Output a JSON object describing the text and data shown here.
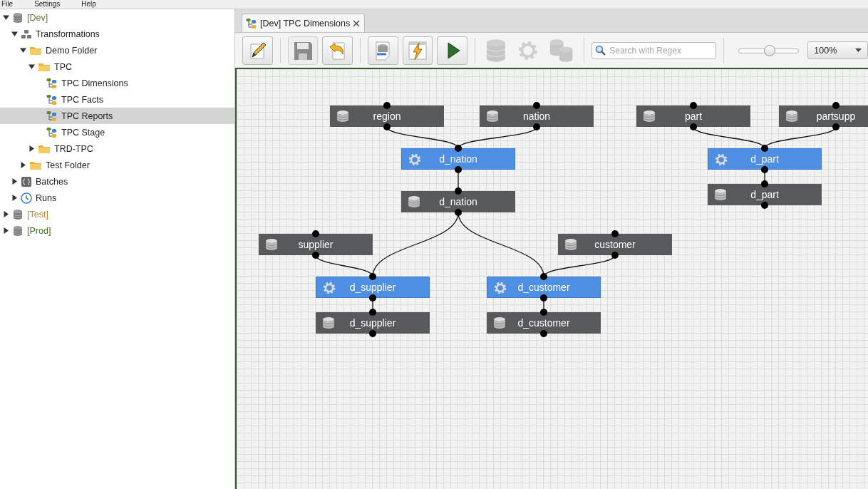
{
  "menu": [
    "File",
    "Settings",
    "Help"
  ],
  "tree": [
    {
      "label": "[Dev]",
      "kind": "env",
      "color": "#5a7a2c",
      "expanded": true,
      "selected": false,
      "children": [
        {
          "label": "Transformations",
          "kind": "transformations",
          "expanded": true,
          "selected": false,
          "children": [
            {
              "label": "Demo Folder",
              "kind": "folder",
              "expanded": true,
              "selected": false,
              "children": [
                {
                  "label": "TPC",
                  "kind": "folder",
                  "expanded": true,
                  "selected": false,
                  "children": [
                    {
                      "label": "TPC Dimensions",
                      "kind": "transformation",
                      "selected": false
                    },
                    {
                      "label": "TPC Facts",
                      "kind": "transformation",
                      "selected": false
                    },
                    {
                      "label": "TPC Reports",
                      "kind": "transformation",
                      "selected": true
                    },
                    {
                      "label": "TPC Stage",
                      "kind": "transformation",
                      "selected": false
                    }
                  ]
                },
                {
                  "label": "TRD-TPC",
                  "kind": "folder",
                  "expanded": false,
                  "selected": false
                }
              ]
            },
            {
              "label": "Test Folder",
              "kind": "folder",
              "expanded": false,
              "selected": false
            }
          ]
        },
        {
          "label": "Batches",
          "kind": "batches",
          "expanded": false,
          "selected": false
        },
        {
          "label": "Runs",
          "kind": "runs",
          "expanded": false,
          "selected": false
        }
      ]
    },
    {
      "label": "[Test]",
      "kind": "env",
      "color": "#b8862c",
      "expanded": false,
      "selected": false
    },
    {
      "label": "[Prod]",
      "kind": "env",
      "color": "#3f6a1e",
      "expanded": false,
      "selected": false
    }
  ],
  "tab": {
    "title": "[Dev] TPC Dimensions",
    "selected": true
  },
  "toolbar": [
    {
      "kind": "edit",
      "disabled": false
    },
    {
      "kind": "save",
      "disabled": true
    },
    {
      "kind": "undo",
      "disabled": false
    },
    {
      "kind": "sql",
      "disabled": false
    },
    {
      "kind": "execute",
      "disabled": false
    },
    {
      "kind": "run",
      "disabled": false
    },
    {
      "kind": "table",
      "disabled": true
    },
    {
      "kind": "transform",
      "disabled": true
    },
    {
      "kind": "tables",
      "disabled": true
    }
  ],
  "search": {
    "placeholder": "Search with Regex"
  },
  "zoom": {
    "level": 0.5,
    "value": "100%"
  },
  "nodes": [
    {
      "label": "region",
      "kind": "table"
    },
    {
      "label": "nation",
      "kind": "table"
    },
    {
      "label": "part",
      "kind": "table"
    },
    {
      "label": "partsupp",
      "kind": "table"
    },
    {
      "label": "d_nation",
      "kind": "transform"
    },
    {
      "label": "d_part",
      "kind": "transform"
    },
    {
      "label": "d_nation",
      "kind": "table"
    },
    {
      "label": "d_part",
      "kind": "table"
    },
    {
      "label": "supplier",
      "kind": "table"
    },
    {
      "label": "customer",
      "kind": "table"
    },
    {
      "label": "d_supplier",
      "kind": "transform"
    },
    {
      "label": "d_customer",
      "kind": "transform"
    },
    {
      "label": "d_supplier",
      "kind": "table"
    },
    {
      "label": "d_customer",
      "kind": "table"
    }
  ]
}
